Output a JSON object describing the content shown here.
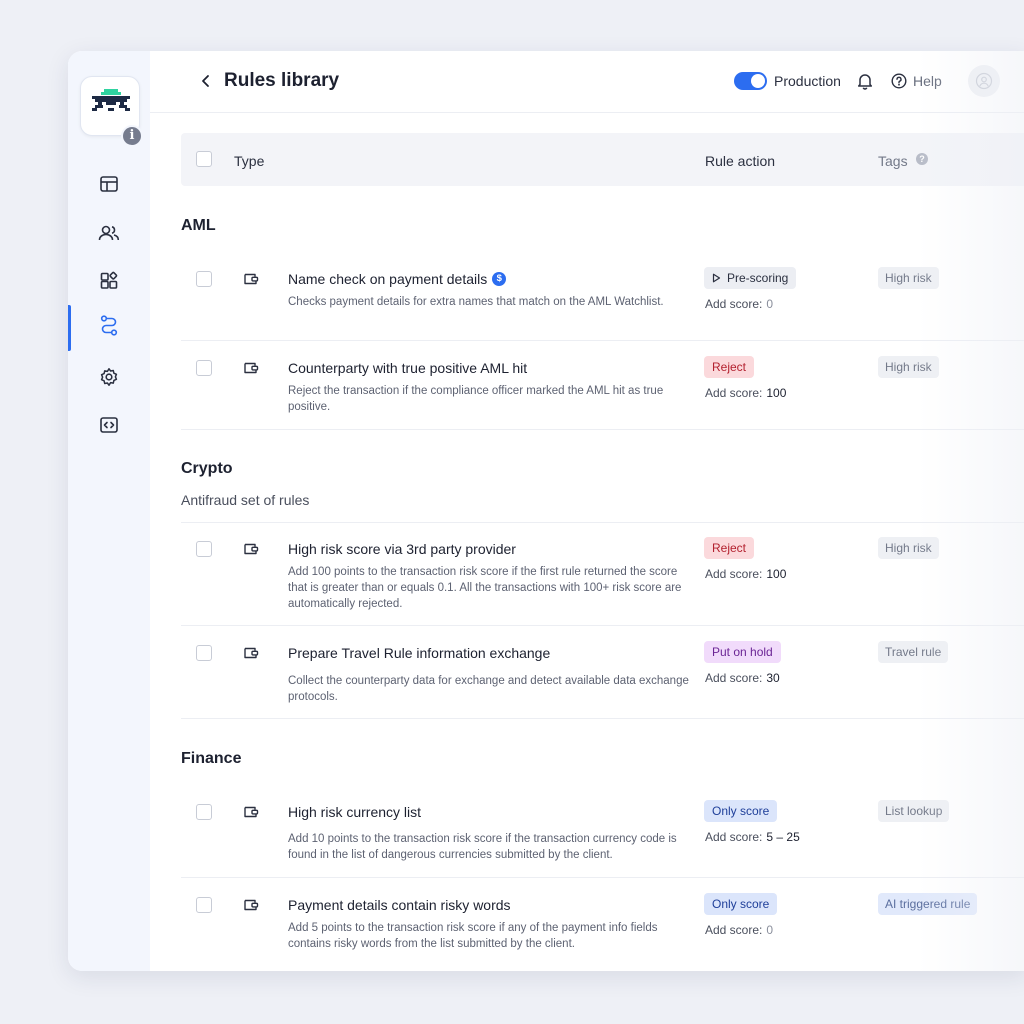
{
  "header": {
    "title": "Rules library",
    "environment": "Production",
    "help_label": "Help"
  },
  "table": {
    "col_type": "Type",
    "col_action": "Rule action",
    "col_tags": "Tags"
  },
  "score_prefix": "Add score:",
  "groups": [
    {
      "title": "AML",
      "description": "",
      "rules": [
        {
          "title": "Name check on payment details",
          "description": "Checks payment details for extra names that match on the AML Watchlist.",
          "action": "Pre-scoring",
          "score": "0",
          "tag": "High risk"
        },
        {
          "title": "Counterparty with true positive AML hit",
          "description": "Reject the transaction if the compliance officer marked the AML hit as true positive.",
          "action": "Reject",
          "score": "100",
          "tag": "High risk"
        }
      ]
    },
    {
      "title": "Crypto",
      "description": "Antifraud set of rules",
      "rules": [
        {
          "title": "High risk score via 3rd party provider",
          "description": "Add 100 points to the transaction risk score if the first rule returned the score that is greater than or equals 0.1. All the transactions with 100+ risk score are automatically rejected.",
          "action": "Reject",
          "score": "100",
          "tag": "High risk"
        },
        {
          "title": "Prepare Travel Rule information exchange",
          "description": "Collect the counterparty data for exchange and detect available data exchange protocols.",
          "action": "Put on hold",
          "score": "30",
          "tag": "Travel rule"
        }
      ]
    },
    {
      "title": "Finance",
      "description": "",
      "rules": [
        {
          "title": "High risk currency list",
          "description": "Add 10 points to the transaction risk score if the transaction currency code is found in the list of dangerous currencies submitted by the client.",
          "action": "Only score",
          "score": "5 – 25",
          "tag": "List lookup"
        },
        {
          "title": "Payment details contain risky words",
          "description": "Add 5 points to the transaction risk score if any of the payment info fields contains risky words from the list submitted by the client.",
          "action": "Only score",
          "score": "0",
          "tag": "AI triggered rule"
        }
      ]
    }
  ],
  "colors": {
    "accent": "#2c6df0",
    "reject_bg": "#fbd9dc",
    "hold_bg": "#f1dbfb",
    "score_bg": "#dbe5fb"
  }
}
